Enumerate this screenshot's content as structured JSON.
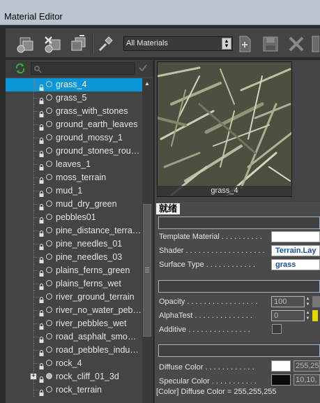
{
  "window": {
    "title": "Material Editor"
  },
  "toolbar": {
    "buttons": [
      {
        "name": "new-material-icon"
      },
      {
        "name": "delete-material-icon"
      },
      {
        "name": "duplicate-material-icon"
      },
      {
        "name": "pick-material-icon"
      },
      {
        "name": "new-file-icon"
      },
      {
        "name": "save-icon"
      },
      {
        "name": "close-icon"
      }
    ],
    "filter_selected": "All Materials"
  },
  "tree": {
    "items": [
      "grass_4",
      "grass_5",
      "grass_with_stones",
      "ground_earth_leaves",
      "ground_mossy_1",
      "ground_stones_rou…",
      "leaves_1",
      "moss_terrain",
      "mud_1",
      "mud_dry_green",
      "pebbles01",
      "pine_distance_terra…",
      "pine_needles_01",
      "pine_needles_03",
      "plains_ferns_green",
      "plains_ferns_wet",
      "river_ground_terrain",
      "river_no_water_peb…",
      "river_pebbles_wet",
      "road_asphalt_smo…",
      "road_pebbles_indu…",
      "rock_4",
      "rock_cliff_01_3d",
      "rock_terrain"
    ],
    "selected_index": 0,
    "expandable_item": "rock_cliff_01_3d"
  },
  "preview": {
    "caption": "grass_4"
  },
  "props": {
    "status_text": "就绪",
    "template_material_label": "Template Material . . . . . . . . . .",
    "shader_label": "Shader . . . . . . . . . . . . . . . . . . .",
    "shader_value": "Terrain.Lay",
    "surface_type_label": "Surface Type . . . . . . . . . . . .",
    "surface_type_value": "grass",
    "opacity_label": "Opacity . . . . . . . . . . . . . . . . .",
    "opacity_value": "100",
    "alphatest_label": "AlphaTest . . . . . . . . . . . . . .",
    "alphatest_value": "0",
    "additive_label": "Additive . . . . . . . . . . . . . . .",
    "diffuse_label": "Diffuse Color . . . . . . . . . . . .",
    "diffuse_value": "255,25",
    "specular_label": "Specular Color . . . . . . . . . . .",
    "specular_value": "10,10,",
    "statusbar_text": "[Color] Diffuse Color = 255,255,255"
  },
  "colors": {
    "selection": "#0a97d9",
    "diffuse_swatch": "#ffffff",
    "specular_swatch": "#0a0a0a"
  }
}
